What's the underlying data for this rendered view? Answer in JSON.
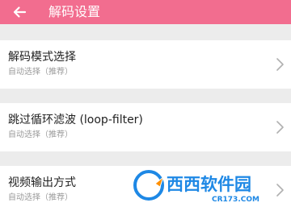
{
  "app_bar": {
    "title": "解码设置",
    "background_color": "#f26d8f",
    "back_icon": "arrow-left-icon"
  },
  "settings": [
    {
      "title": "解码模式选择",
      "subtitle": "自动选择（推荐）",
      "icon": "chevron-right-icon"
    },
    {
      "title": "跳过循环滤波 (loop-filter)",
      "subtitle": "自动选择（推荐）",
      "icon": "chevron-right-icon"
    },
    {
      "title": "视频输出方式",
      "subtitle": "自动选择（推荐）",
      "icon": "chevron-right-icon"
    }
  ],
  "watermark": {
    "brand": "西西软件园",
    "domain": "CR173.COM",
    "icon": "cr-logo-icon"
  }
}
